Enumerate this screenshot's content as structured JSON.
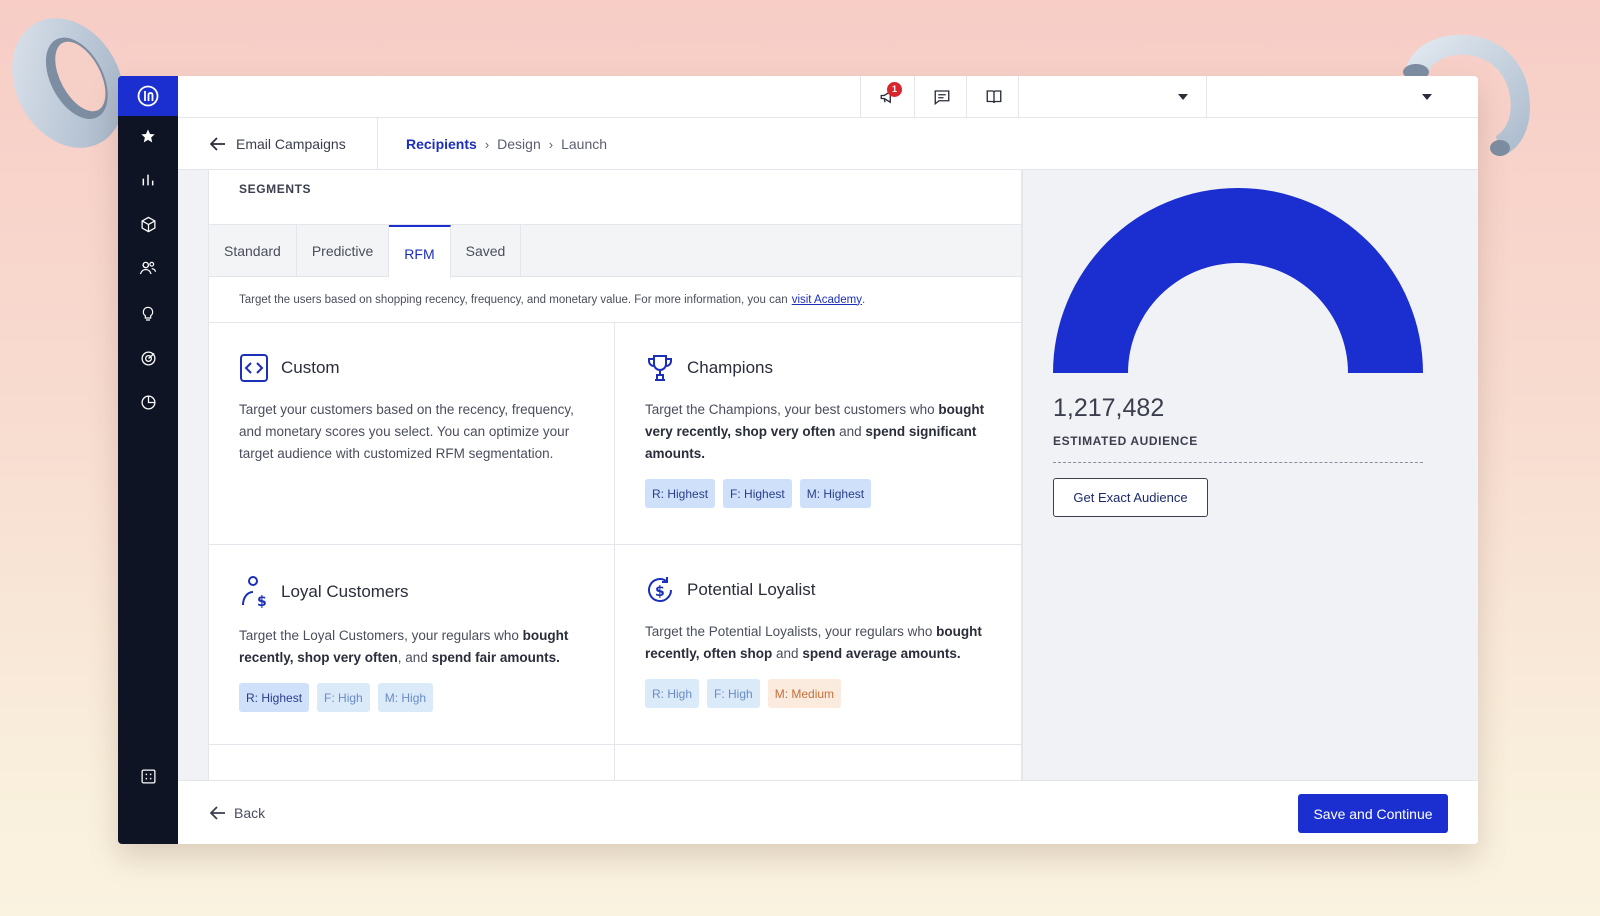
{
  "topbar": {
    "notification_count": "1"
  },
  "breadcrumb": {
    "back_label": "Email Campaigns",
    "steps": [
      "Recipients",
      "Design",
      "Launch"
    ]
  },
  "segments": {
    "title": "SEGMENTS",
    "tabs": [
      "Standard",
      "Predictive",
      "RFM",
      "Saved"
    ],
    "active_tab": "RFM",
    "hint": "Target the users based on shopping recency, frequency, and monetary value. For more information, you can",
    "hint_link": "visit Academy",
    "cards": [
      {
        "icon": "code-icon",
        "title": "Custom",
        "desc_parts": [
          {
            "t": "Target your customers based on the recency, frequency, and monetary scores you select. You can optimize your target audience with customized RFM segmentation.",
            "b": false
          }
        ],
        "tags": []
      },
      {
        "icon": "trophy-icon",
        "title": "Champions",
        "desc_parts": [
          {
            "t": "Target the Champions, your best customers who ",
            "b": false
          },
          {
            "t": "bought very recently, shop very often",
            "b": true
          },
          {
            "t": " and ",
            "b": false
          },
          {
            "t": "spend significant amounts.",
            "b": true
          }
        ],
        "tags": [
          {
            "label": "R: Highest",
            "style": "blue-strong"
          },
          {
            "label": "F: Highest",
            "style": "blue-strong"
          },
          {
            "label": "M: Highest",
            "style": "blue-strong"
          }
        ]
      },
      {
        "icon": "user-dollar-icon",
        "title": "Loyal Customers",
        "desc_parts": [
          {
            "t": "Target the Loyal Customers, your regulars who ",
            "b": false
          },
          {
            "t": "bought recently, shop very often",
            "b": true
          },
          {
            "t": ", and ",
            "b": false
          },
          {
            "t": "spend fair amounts.",
            "b": true
          }
        ],
        "tags": [
          {
            "label": "R: Highest",
            "style": "blue-strong"
          },
          {
            "label": "F: High",
            "style": "blue-light"
          },
          {
            "label": "M: High",
            "style": "blue-light"
          }
        ]
      },
      {
        "icon": "dollar-cycle-icon",
        "title": "Potential Loyalist",
        "desc_parts": [
          {
            "t": "Target the Potential Loyalists, your regulars who ",
            "b": false
          },
          {
            "t": "bought recently, often shop",
            "b": true
          },
          {
            "t": " and ",
            "b": false
          },
          {
            "t": "spend average amounts.",
            "b": true
          }
        ],
        "tags": [
          {
            "label": "R: High",
            "style": "blue-light"
          },
          {
            "label": "F: High",
            "style": "blue-light"
          },
          {
            "label": "M: Medium",
            "style": "orange"
          }
        ]
      }
    ]
  },
  "audience": {
    "count": "1,217,482",
    "label": "ESTIMATED AUDIENCE",
    "button": "Get Exact Audience",
    "gauge_color": "#1b2fd0"
  },
  "footer": {
    "back": "Back",
    "save": "Save and Continue"
  },
  "colors": {
    "accent": "#1b2fd0",
    "rail": "#0f1424"
  }
}
